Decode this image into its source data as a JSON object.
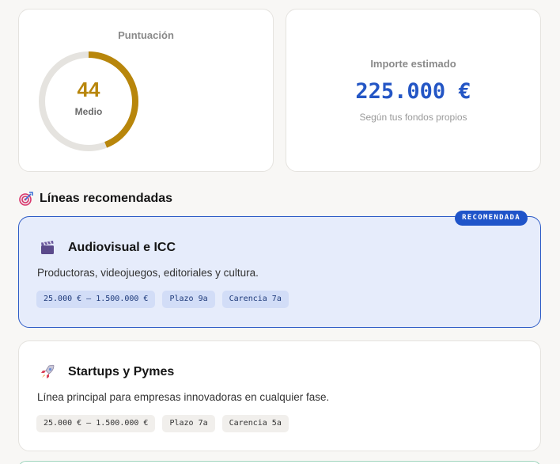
{
  "score": {
    "title": "Puntuación",
    "value": "44",
    "level": "Medio",
    "progress_percent": 44,
    "ring_color": "#b8860b",
    "track_color": "#e5e3df"
  },
  "amount": {
    "title": "Importe estimado",
    "value": "225.000 €",
    "subtitle": "Según tus fondos propios"
  },
  "section": {
    "icon": "target-icon",
    "title": "Líneas recomendadas"
  },
  "lines": [
    {
      "badge": "RECOMENDADA",
      "icon": "clapperboard-icon",
      "title": "Audiovisual e ICC",
      "description": "Productoras, videojuegos, editoriales y cultura.",
      "chips": [
        "25.000 € – 1.500.000 €",
        "Plazo 9a",
        "Carencia 7a"
      ]
    },
    {
      "icon": "rocket-icon",
      "title": "Startups y Pymes",
      "description": "Línea principal para empresas innovadoras en cualquier fase.",
      "chips": [
        "25.000 € – 1.500.000 €",
        "Plazo 7a",
        "Carencia 5a"
      ]
    }
  ]
}
